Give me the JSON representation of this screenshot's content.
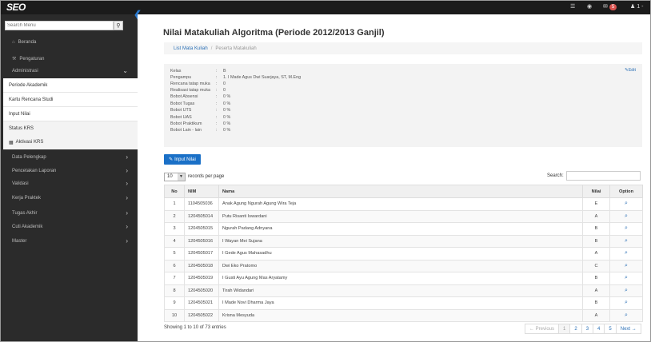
{
  "topbar": {
    "brand": "SEO",
    "badge": "5",
    "user": "1 -"
  },
  "sidebar": {
    "search_placeholder": "Search Menu",
    "items_top": [
      {
        "label": "Beranda"
      },
      {
        "label": "Pengaturan"
      },
      {
        "label": "Administrasi"
      }
    ],
    "submenu": [
      {
        "label": "Periode Akademik"
      },
      {
        "label": "Kartu Rencana Studi"
      },
      {
        "label": "Input Nilai"
      },
      {
        "label": "Status KRS"
      },
      {
        "label": "Aktivasi KRS"
      }
    ],
    "items_bottom": [
      {
        "label": "Data Pelengkap"
      },
      {
        "label": "Pencetakan Laporan"
      },
      {
        "label": "Validasi"
      },
      {
        "label": "Kerja Praktek"
      },
      {
        "label": "Tugas Akhir"
      },
      {
        "label": "Cuti Akademik"
      },
      {
        "label": "Master"
      }
    ]
  },
  "page": {
    "title": "Nilai Matakuliah Algoritma (Periode 2012/2013 Ganjil)",
    "breadcrumb": {
      "link": "List Mata Kuliah",
      "current": "Peserta Matakuliah"
    },
    "edit_label": "Edit",
    "info": [
      {
        "key": "Kelas",
        "value": "B"
      },
      {
        "key": "Pengampu",
        "value": "1. I Made Agus Dwi Suarjaya, ST, M.Eng"
      },
      {
        "key": "Rencana tatap muka",
        "value": "0"
      },
      {
        "key": "Realisasi tatap muka",
        "value": "0"
      },
      {
        "key": "Bobot Absensi",
        "value": "0 %"
      },
      {
        "key": "Bobot Tugas",
        "value": "0 %"
      },
      {
        "key": "Bobot UTS",
        "value": "0 %"
      },
      {
        "key": "Bobot UAS",
        "value": "0 %"
      },
      {
        "key": "Bobot Praktikum",
        "value": "0 %"
      },
      {
        "key": "Bobot Lain - lain",
        "value": "0 %"
      }
    ],
    "input_button": "Input Nilai",
    "length_value": "10",
    "length_suffix": "records per page",
    "search_label": "Search:",
    "table": {
      "headers": [
        "No",
        "NIM",
        "Nama",
        "Nilai",
        "Option"
      ],
      "rows": [
        {
          "no": "1",
          "nim": "1104505036",
          "nama": "Anak Agung Ngurah Agung Wira Teja",
          "nilai": "E"
        },
        {
          "no": "2",
          "nim": "1204505014",
          "nama": "Putu Risanti Iswardani",
          "nilai": "A"
        },
        {
          "no": "3",
          "nim": "1204505015",
          "nama": "Ngurah Padang Adnyana",
          "nilai": "B"
        },
        {
          "no": "4",
          "nim": "1204505016",
          "nama": "I Wayan Mei Sujana",
          "nilai": "B"
        },
        {
          "no": "5",
          "nim": "1204505017",
          "nama": "I Gede Agus Mahasadhu",
          "nilai": "A"
        },
        {
          "no": "6",
          "nim": "1204505018",
          "nama": "Dwi Eko Pratomo",
          "nilai": "C"
        },
        {
          "no": "7",
          "nim": "1204505019",
          "nama": "I Gusti Ayu Agung Mas Aryatamy",
          "nilai": "B"
        },
        {
          "no": "8",
          "nim": "1204505020",
          "nama": "Tirah Widandari",
          "nilai": "A"
        },
        {
          "no": "9",
          "nim": "1204505021",
          "nama": "I Made Novi Dharma Jaya",
          "nilai": "B"
        },
        {
          "no": "10",
          "nim": "1204505022",
          "nama": "Krisna Mesyuda",
          "nilai": "A"
        }
      ]
    },
    "showing": "Showing 1 to 10 of 73 entries",
    "pager": {
      "prev": "← Previous",
      "pages": [
        "1",
        "2",
        "3",
        "4",
        "5"
      ],
      "next": "Next →"
    }
  }
}
